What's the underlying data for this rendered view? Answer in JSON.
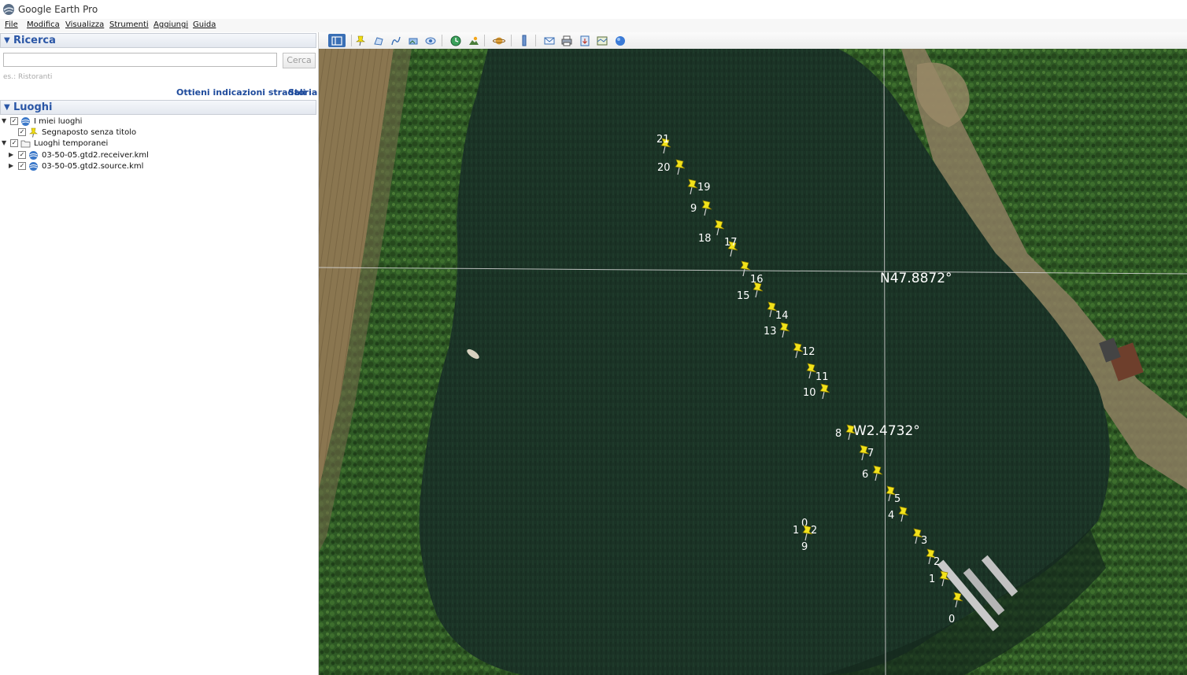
{
  "window": {
    "title": "Google Earth Pro"
  },
  "menu": [
    {
      "id": "file",
      "label": "File"
    },
    {
      "id": "modifica",
      "label": "Modifica"
    },
    {
      "id": "visualizza",
      "label": "Visualizza"
    },
    {
      "id": "strumenti",
      "label": "Strumenti"
    },
    {
      "id": "aggiungi",
      "label": "Aggiungi"
    },
    {
      "id": "guida",
      "label": "Guida"
    }
  ],
  "search": {
    "header": "Ricerca",
    "value": "",
    "placeholder": "",
    "button": "Cerca",
    "hint": "es.: Ristoranti",
    "link_directions": "Ottieni indicazioni stradali",
    "link_history": "Storia"
  },
  "places": {
    "header": "Luoghi",
    "items": [
      {
        "label": "I miei luoghi",
        "checked": true,
        "icon": "network-globe-icon"
      },
      {
        "label": "Segnaposto senza titolo",
        "checked": true,
        "icon": "pushpin-icon"
      },
      {
        "label": "Luoghi temporanei",
        "checked": true,
        "icon": "folder-icon"
      },
      {
        "label": "03-50-05.gtd2.receiver.kml",
        "checked": true,
        "icon": "kml-globe-icon"
      },
      {
        "label": "03-50-05.gtd2.source.kml",
        "checked": true,
        "icon": "kml-globe-icon"
      }
    ]
  },
  "toolbar": {
    "buttons": [
      "sidebar-toggle-icon",
      "add-placemark-icon",
      "add-polygon-icon",
      "add-path-icon",
      "add-image-overlay-icon",
      "record-tour-icon",
      "historical-imagery-icon",
      "sunlight-icon",
      "planets-icon",
      "ruler-icon",
      "email-icon",
      "print-icon",
      "save-image-icon",
      "view-in-maps-icon",
      "sign-in-icon"
    ]
  },
  "map": {
    "grid_labels": {
      "latitude": "N47.8872°",
      "longitude": "W2.4732°"
    },
    "colors": {
      "water": "#1b3325",
      "forest": "#2e5a24",
      "field": "#8f7a52",
      "pin": "#f2e21a"
    },
    "receiver_pins": [
      "21",
      "20",
      "19",
      "9",
      "18",
      "17",
      "16",
      "15",
      "14",
      "13",
      "12",
      "11",
      "10",
      "8",
      "7",
      "6",
      "5",
      "4",
      "3",
      "2",
      "1",
      "0"
    ],
    "source_cluster_labels": [
      "0",
      "1",
      "2",
      "9"
    ]
  }
}
